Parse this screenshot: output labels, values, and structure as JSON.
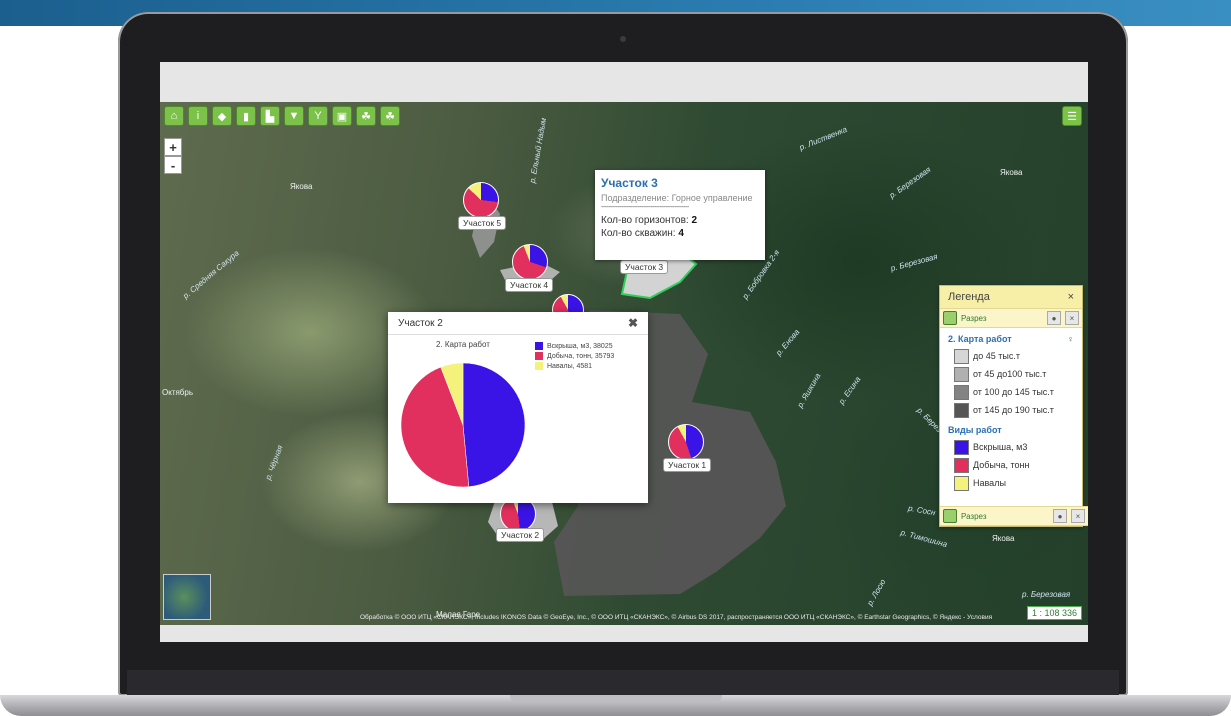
{
  "map": {
    "rivers": [
      "р. Лиственка",
      "р. Березовая",
      "р. Бобровка 2-я",
      "р. Березовая",
      "р. Енова",
      "р. Яшкина",
      "р. Есина",
      "р. Березова",
      "р. Сосн",
      "р. Тимошина",
      "р. Лосю",
      "р. Березовая",
      "р. Средняя Сакура",
      "р. Чёрная",
      "р. Ельный Надым"
    ],
    "places": [
      "Октябрь",
      "Малая Гаре",
      "Якова",
      "Якова",
      "Якова"
    ],
    "sites": [
      "Участок 5",
      "Участок 4",
      "Участок 3",
      "Участок 1",
      "Участок 2"
    ],
    "scale": "1 : 108 336",
    "attribution": "Обработка © ООО ИТЦ «СКАНЭКС», Includes IKONOS Data © GeoEye, Inc., © ООО ИТЦ «СКАНЭКС», © Airbus DS 2017, распространяется ООО ИТЦ «СКАНЭКС», © Earthstar Geographics, © Яндекс - Условия"
  },
  "toolbar": {
    "zoom_in": "+",
    "zoom_out": "-"
  },
  "info_popup": {
    "title": "Участок 3",
    "subdivision": "Подразделение: Горное управление",
    "separator": "------------------------------------------------",
    "horizons_label": "Кол-во горизонтов:",
    "horizons_value": "2",
    "wells_label": "Кол-во скважин:",
    "wells_value": "4"
  },
  "chart_window": {
    "header": "Участок 2",
    "close": "✖"
  },
  "chart_data": {
    "type": "pie",
    "title": "2. Карта работ",
    "categories": [
      "Вскрыша, м3, 38025",
      "Добыча, тонн, 35793",
      "Навалы, 4581"
    ],
    "values": [
      38025,
      35793,
      4581
    ],
    "colors": [
      "#3a14e6",
      "#e2305e",
      "#f4f27a"
    ],
    "legend": "right"
  },
  "legend_panel": {
    "title": "Легенда",
    "close": "×",
    "layer_top": "Разрез",
    "layer_bottom": "Разрез",
    "section1": "2. Карта работ",
    "scale_items": [
      "до 45 тыс.т",
      "от 45 до100 тыс.т",
      "от 100 до 145 тыс.т",
      "от 145 до 190 тыс.т"
    ],
    "scale_colors": [
      "#d6d6d6",
      "#b0b0b0",
      "#838383",
      "#565656"
    ],
    "section2": "Виды работ",
    "work_items": [
      "Вскрыша, м3",
      "Добыча, тонн",
      "Навалы"
    ],
    "work_colors": [
      "#3a14e6",
      "#e2305e",
      "#f4f27a"
    ]
  }
}
